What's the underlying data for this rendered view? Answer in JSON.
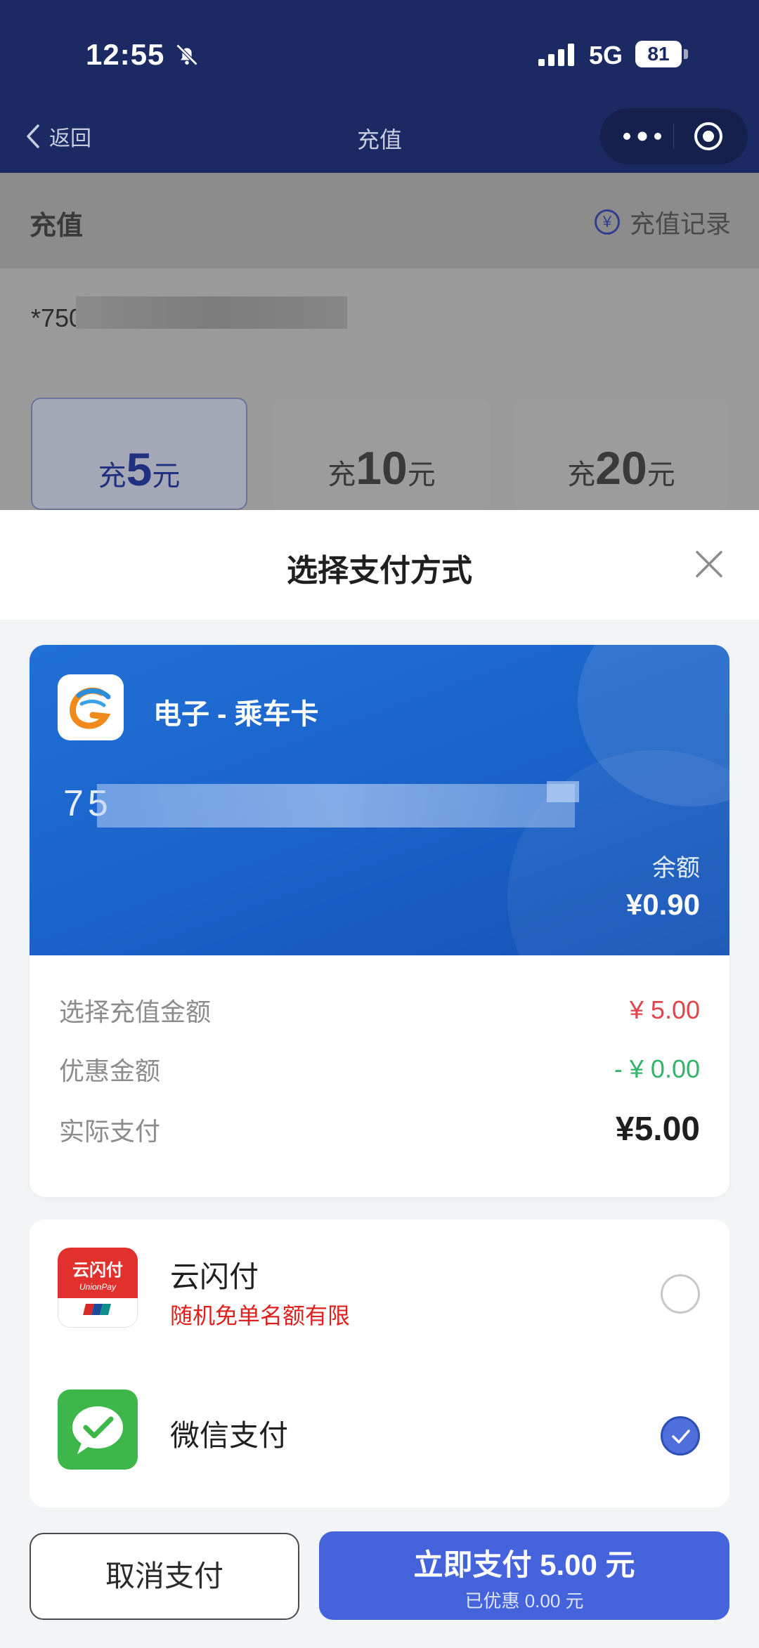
{
  "status_bar": {
    "time": "12:55",
    "network": "5G",
    "battery": "81"
  },
  "nav": {
    "back_label": "返回",
    "title": "充值"
  },
  "background": {
    "header_title": "充值",
    "record_link": "充值记录",
    "card_number_prefix": "*750",
    "amount_options": [
      {
        "prefix": "充",
        "value": "5",
        "suffix": "元",
        "selected": true
      },
      {
        "prefix": "充",
        "value": "10",
        "suffix": "元",
        "selected": false
      },
      {
        "prefix": "充",
        "value": "20",
        "suffix": "元",
        "selected": false
      }
    ]
  },
  "sheet": {
    "title": "选择支付方式",
    "card": {
      "name": "电子 - 乘车卡",
      "number_prefix": "75",
      "balance_label": "余额",
      "balance_value": "¥0.90"
    },
    "summary": {
      "recharge_label": "选择充值金额",
      "recharge_value": "¥ 5.00",
      "discount_label": "优惠金额",
      "discount_value": "- ¥ 0.00",
      "actual_label": "实际支付",
      "actual_value": "¥5.00"
    },
    "payment_methods": [
      {
        "name": "云闪付",
        "promo": "随机免单名额有限",
        "icon": "unionpay-icon",
        "icon_text": "云闪付",
        "icon_subtext": "UnionPay",
        "selected": false
      },
      {
        "name": "微信支付",
        "promo": "",
        "icon": "wechat-pay-icon",
        "selected": true
      }
    ],
    "buttons": {
      "cancel_label": "取消支付",
      "pay_label": "立即支付 5.00 元",
      "pay_sub": "已优惠 0.00 元"
    }
  },
  "colors": {
    "nav_bg": "#1c2a63",
    "primary": "#4564dc",
    "card_blue": "#1a62c8",
    "price_red": "#e0454b",
    "discount_green": "#34b36b",
    "promo_red": "#e0201c",
    "wechat_green": "#3db64a",
    "unionpay_red": "#e2312d"
  }
}
